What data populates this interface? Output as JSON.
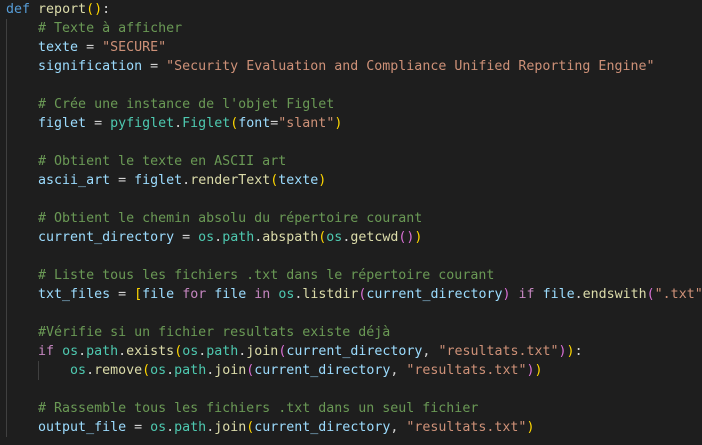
{
  "code": {
    "func_def": {
      "kw": "def",
      "name": "report",
      "tail": ":"
    },
    "comment_texte": "# Texte à afficher",
    "texte": {
      "var": "texte",
      "value": "\"SECURE\""
    },
    "signification": {
      "var": "signification",
      "value": "\"Security Evaluation and Compliance Unified Reporting Engine\""
    },
    "comment_figlet": "# Crée une instance de l'objet Figlet",
    "figlet": {
      "var": "figlet",
      "module": "pyfiglet",
      "cls": "Figlet",
      "param": "font",
      "value": "\"slant\""
    },
    "comment_ascii": "# Obtient le texte en ASCII art",
    "ascii_art": {
      "var": "ascii_art",
      "obj": "figlet",
      "method": "renderText",
      "arg": "texte"
    },
    "comment_dir": "# Obtient le chemin absolu du répertoire courant",
    "current_directory": {
      "var": "current_directory",
      "mod": "os",
      "sub": "path",
      "method": "abspath",
      "inner_method": "getcwd"
    },
    "comment_list": "# Liste tous les fichiers .txt dans le répertoire courant",
    "txt_files": {
      "var": "txt_files",
      "item": "file",
      "kw_for": "for",
      "kw_in": "in",
      "mod": "os",
      "method": "listdir",
      "arg": "current_directory",
      "kw_if": "if",
      "method2": "endswith",
      "str": "\".txt\""
    },
    "comment_verif": "#Vérifie si un fichier resultats existe déjà",
    "if_exists": {
      "kw": "if",
      "mod": "os",
      "sub": "path",
      "method": "exists",
      "method2": "join",
      "arg": "current_directory",
      "str": "\"resultats.txt\""
    },
    "remove": {
      "mod": "os",
      "method": "remove",
      "sub": "path",
      "method2": "join",
      "arg": "current_directory",
      "str": "\"resultats.txt\""
    },
    "comment_rassemble": "# Rassemble tous les fichiers .txt dans un seul fichier",
    "output_file": {
      "var": "output_file",
      "mod": "os",
      "sub": "path",
      "method": "join",
      "arg": "current_directory",
      "str": "\"resultats.txt\""
    }
  }
}
